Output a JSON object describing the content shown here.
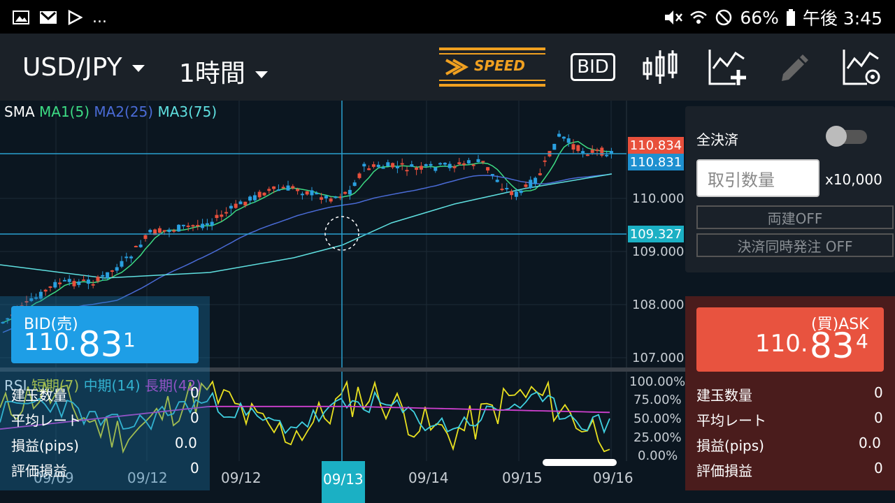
{
  "statusbar": {
    "left_icons": [
      "image-icon",
      "gmail-icon",
      "play-store-icon"
    ],
    "ellipsis": "...",
    "battery": "66%",
    "time": "午後 3:45"
  },
  "toolbar": {
    "pair": "USD/JPY",
    "timeframe": "1時間",
    "speed_label": "SPEED",
    "bid_label": "BID"
  },
  "chart": {
    "sma_label": "SMA",
    "ma1": "MA1(5)",
    "ma2": "MA2(25)",
    "ma3": "MA3(75)",
    "y_ticks": [
      "110.000",
      "109.000",
      "108.000",
      "107.000"
    ],
    "tags": {
      "ask_tag": "110.834",
      "bid_tag": "110.831",
      "cross_tag": "109.327"
    },
    "rsi_label": "RSI",
    "rsi_short": "短期(7)",
    "rsi_mid": "中期(14)",
    "rsi_long": "長期(42)",
    "rsi_ticks": [
      "100.00%",
      "75.00%",
      "50.00%",
      "25.00%",
      "0.00%"
    ],
    "dates": [
      "09/09",
      "09/12",
      "09/12",
      "09/13",
      "09/14",
      "09/15",
      "09/16"
    ],
    "colors": {
      "ma1": "#3ddc84",
      "ma2": "#4a6bd6",
      "ma3": "#5fe0e0",
      "up": "#e8503c",
      "down": "#2aa0e0",
      "rsi_short": "#e8e020",
      "rsi_mid": "#40d0e0",
      "rsi_long": "#d040d0"
    }
  },
  "bid": {
    "label": "BID(売)",
    "price_main": "110.",
    "price_big": "83",
    "price_small": "1",
    "rows": [
      {
        "label": "建玉数量",
        "value": "0"
      },
      {
        "label": "平均レート",
        "value": "0"
      },
      {
        "label": "損益(pips)",
        "value": "0.0"
      },
      {
        "label": "評価損益",
        "value": "0"
      }
    ]
  },
  "order": {
    "close_all": "全決済",
    "qty_placeholder": "取引数量",
    "unit": "x10,000",
    "hedge": "両建OFF",
    "simul": "決済同時発注 OFF"
  },
  "ask": {
    "label": "(買)ASK",
    "price_main": "110.",
    "price_big": "83",
    "price_small": "4",
    "rows": [
      {
        "label": "建玉数量",
        "value": "0"
      },
      {
        "label": "平均レート",
        "value": "0"
      },
      {
        "label": "損益(pips)",
        "value": "0.0"
      },
      {
        "label": "評価損益",
        "value": "0"
      }
    ]
  }
}
